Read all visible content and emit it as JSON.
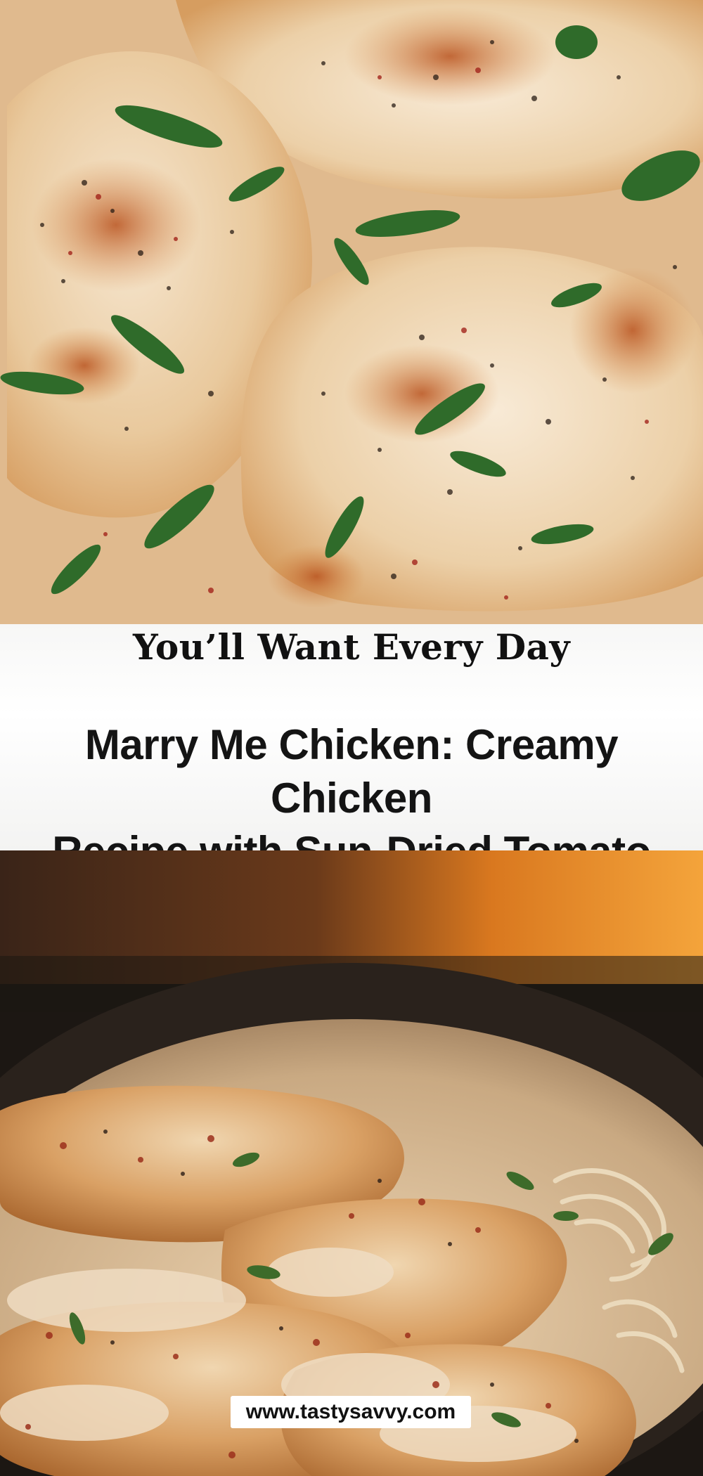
{
  "pin": {
    "subtitle": "You’ll Want Every Day",
    "title_line_1": "Marry Me Chicken: Creamy Chicken",
    "title_line_2": "Recipe with Sun-Dried Tomato Sauce",
    "website": "www.tastysavvy.com"
  },
  "photos": {
    "top": "chicken-breasts-creamy-sauce-basil-image",
    "bottom": "chicken-in-skillet-with-pasta-image"
  },
  "colors": {
    "sauce": "#e6c9a2",
    "chicken": "#f1dcc0",
    "seared": "#c8782e",
    "basil": "#2f6b2a",
    "skillet": "#1c1713",
    "fire": "#e8902a"
  }
}
